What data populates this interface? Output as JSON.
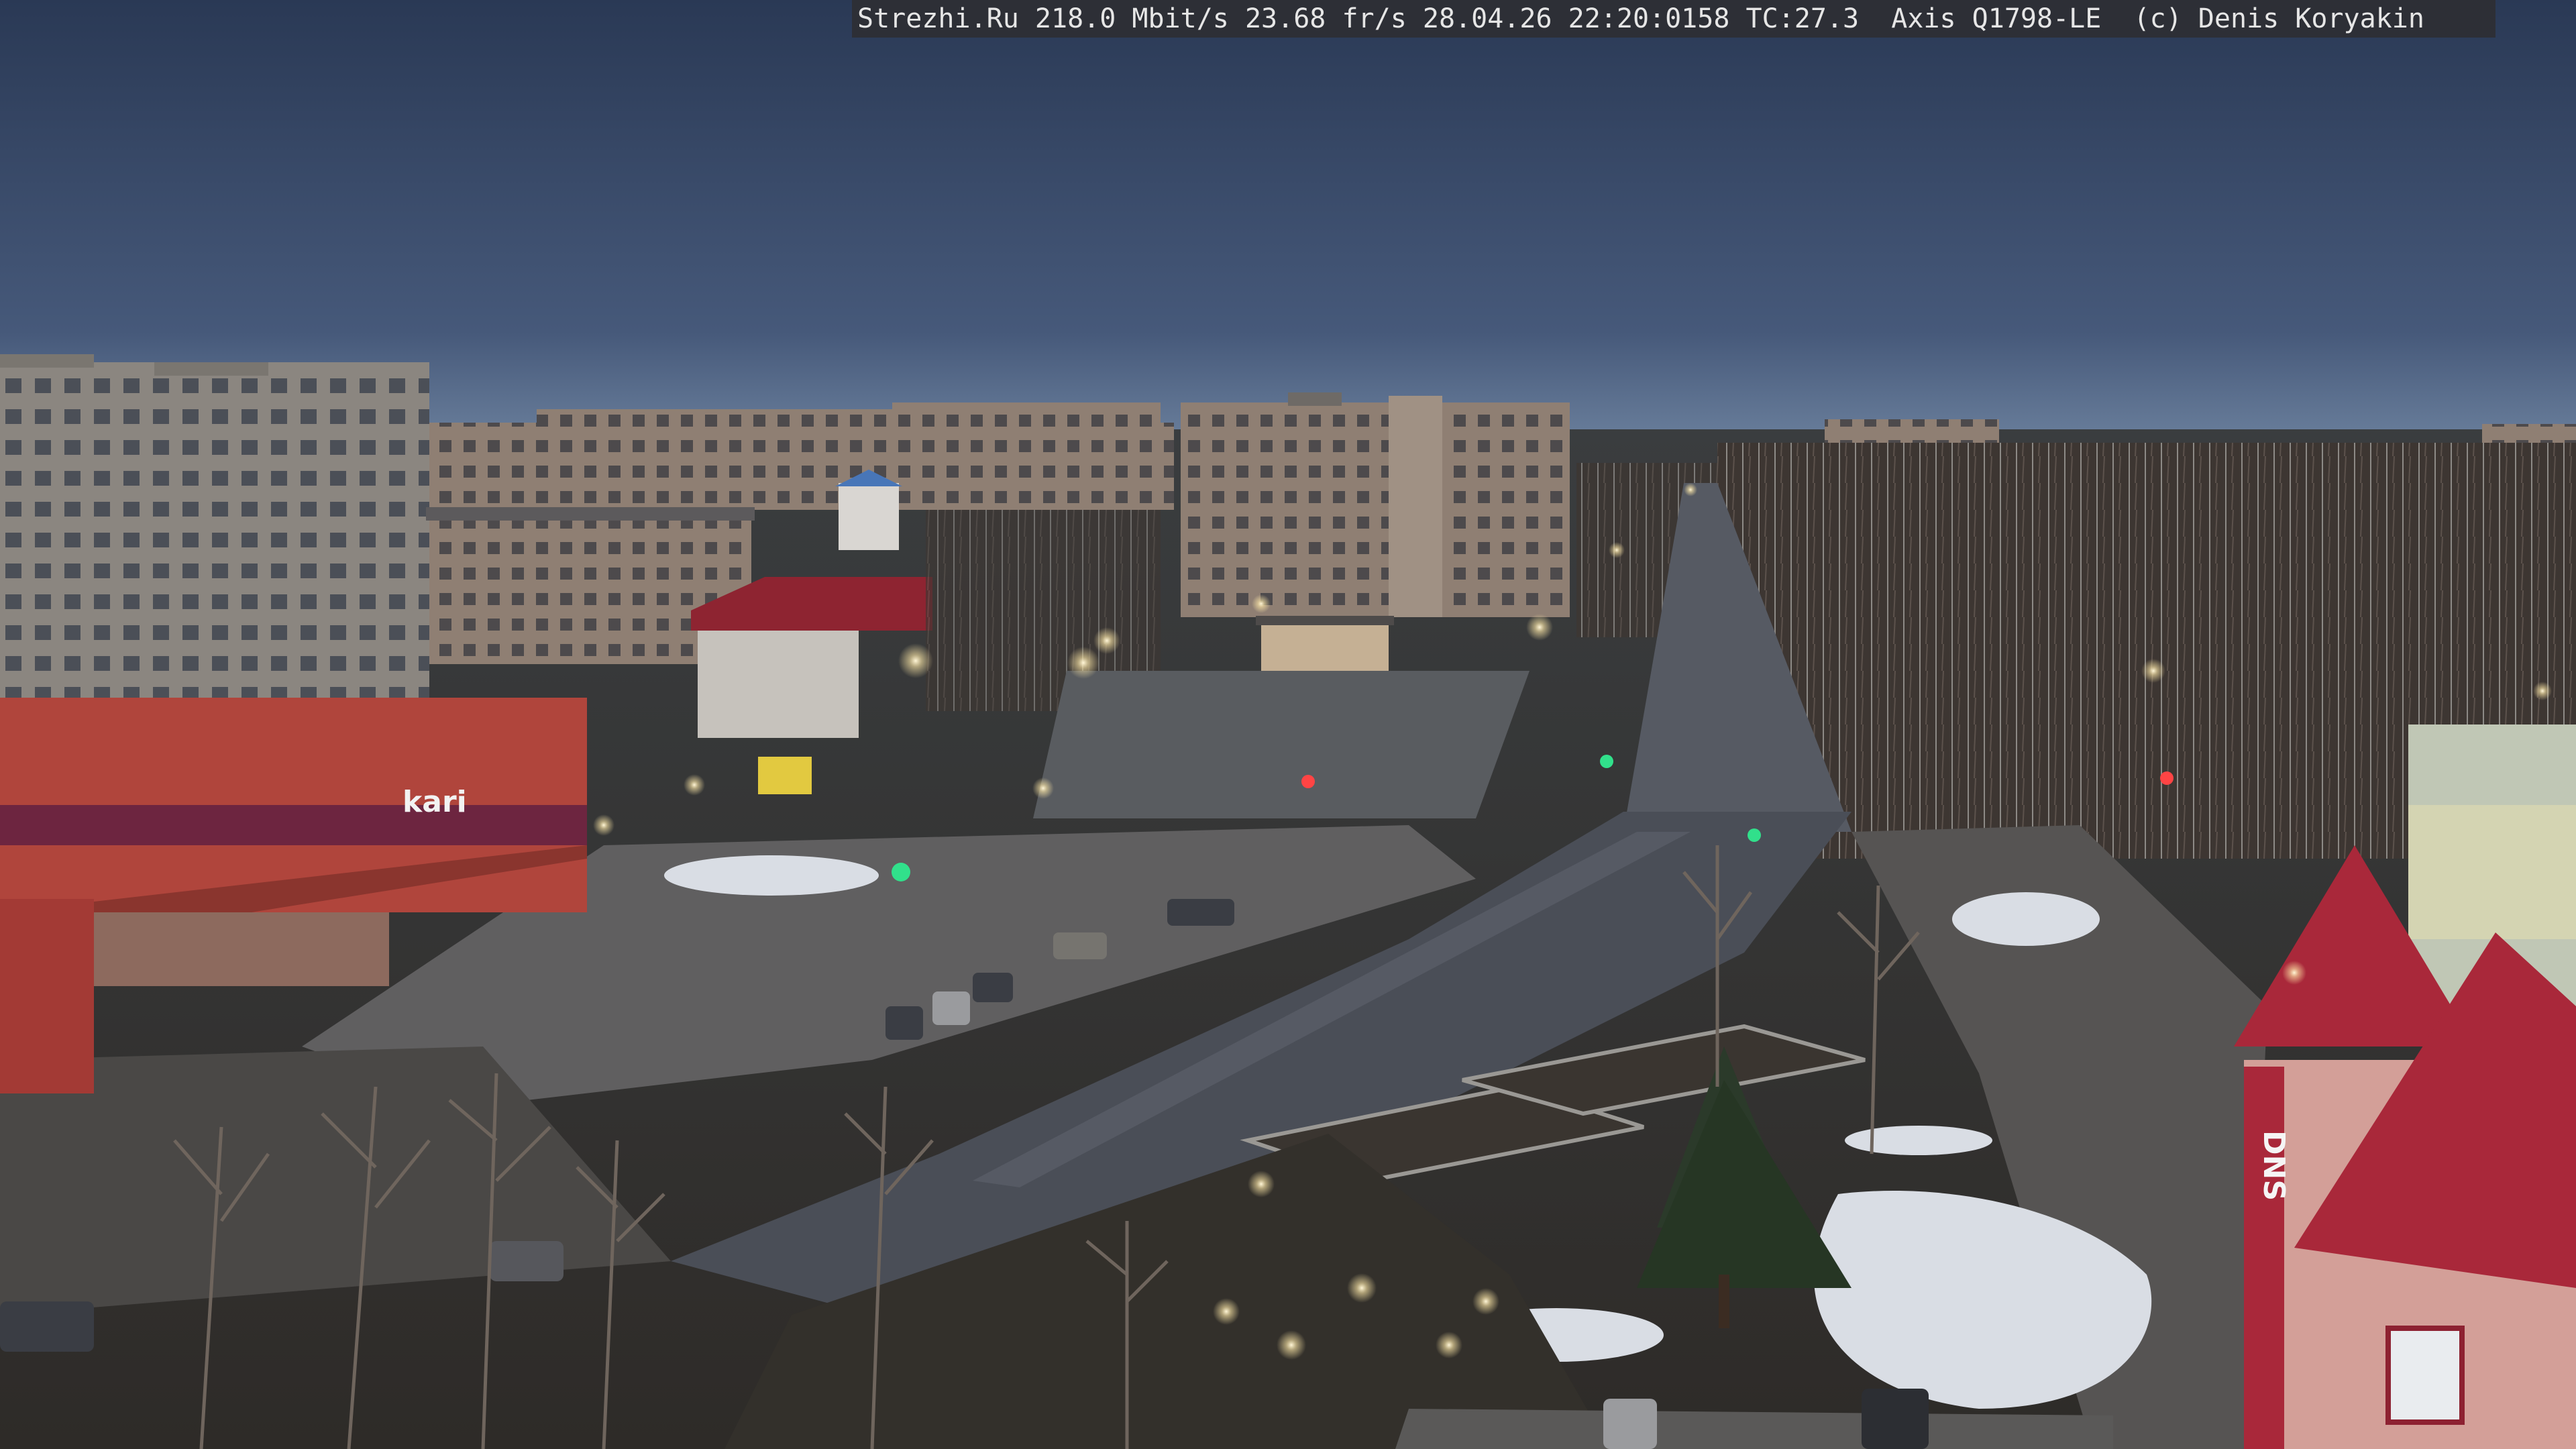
{
  "overlay": {
    "text": "Strezhi.Ru 218.0 Mbit/s 23.68 fr/s 28.04.26 22:20:0158 TC:27.3  Axis Q1798-LE  (c) Denis Koryakin"
  },
  "signs": {
    "store_left": "kari",
    "store_right": "DNS"
  },
  "colors": {
    "sky_top": "#2c3c58",
    "sky_horizon": "#5d7594",
    "road": "#4a4e57",
    "brick": "#b0453c",
    "roof_red": "#a8283a"
  }
}
